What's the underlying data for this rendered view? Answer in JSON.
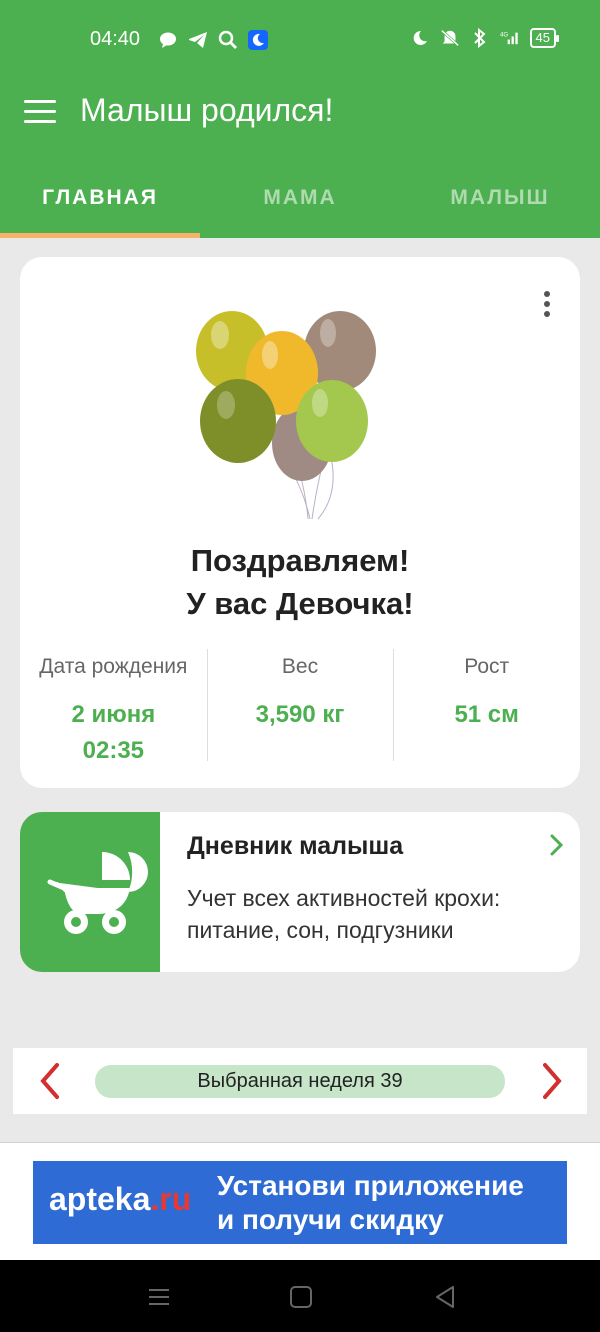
{
  "status_bar": {
    "time": "04:40",
    "battery": "45",
    "network": "4G"
  },
  "app_bar": {
    "title": "Малыш родился!"
  },
  "tabs": [
    {
      "label": "ГЛАВНАЯ",
      "active": true
    },
    {
      "label": "МАМА",
      "active": false
    },
    {
      "label": "МАЛЫШ",
      "active": false
    }
  ],
  "baby_card": {
    "congrats_line1": "Поздравляем!",
    "congrats_line2": "У вас Девочка!",
    "stats": [
      {
        "label": "Дата рождения",
        "value_line1": "2 июня",
        "value_line2": "02:35"
      },
      {
        "label": "Вес",
        "value_line1": "3,590 кг",
        "value_line2": ""
      },
      {
        "label": "Рост",
        "value_line1": "51 см",
        "value_line2": ""
      }
    ]
  },
  "diary_card": {
    "title": "Дневник малыша",
    "description": "Учет всех активностей крохи: питание, сон, подгузники"
  },
  "week_selector": {
    "label": "Выбранная неделя 39"
  },
  "ad_banner": {
    "brand_main": "apteka",
    "brand_suffix": ".ru",
    "slogan_line1": "Установи приложение",
    "slogan_line2": "и получи скидку"
  },
  "colors": {
    "primary": "#4caf50",
    "tab_indicator": "#f5b26b",
    "accent_red": "#d32f2f",
    "ad_blue": "#2e6bd4"
  },
  "icons": [
    "menu-icon",
    "more-vert-icon",
    "stroller-icon",
    "chevron-right-icon",
    "arrow-left-icon",
    "arrow-right-icon"
  ]
}
